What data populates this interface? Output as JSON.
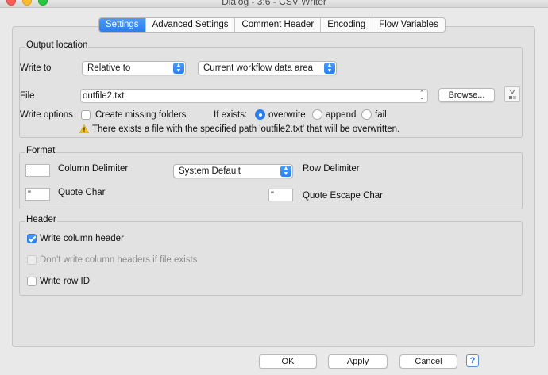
{
  "window": {
    "title": "Dialog - 3:6 - CSV Writer"
  },
  "tabs": [
    {
      "label": "Settings"
    },
    {
      "label": "Advanced Settings"
    },
    {
      "label": "Comment Header"
    },
    {
      "label": "Encoding"
    },
    {
      "label": "Flow Variables"
    }
  ],
  "output_location": {
    "title": "Output location",
    "write_to_label": "Write to",
    "write_to_value": "Relative to",
    "area_value": "Current workflow data area",
    "file_label": "File",
    "file_value": "outfile2.txt",
    "browse_label": "Browse...",
    "write_options_label": "Write options",
    "create_missing_folders": "Create missing folders",
    "if_exists_label": "If exists:",
    "overwrite_label": "overwrite",
    "append_label": "append",
    "fail_label": "fail",
    "warning": "There exists a file with the specified path 'outfile2.txt' that will be overwritten."
  },
  "format": {
    "title": "Format",
    "column_delimiter_label": "Column Delimiter",
    "column_delimiter_value": "",
    "row_delimiter_label": "Row Delimiter",
    "row_delimiter_value": "System Default",
    "quote_char_label": "Quote Char",
    "quote_char_value": "\"",
    "quote_escape_label": "Quote Escape Char",
    "quote_escape_value": "\""
  },
  "header": {
    "title": "Header",
    "write_column_header": "Write column header",
    "dont_write_if_exists": "Don't write column headers if file exists",
    "write_row_id": "Write row ID"
  },
  "buttons": {
    "ok": "OK",
    "apply": "Apply",
    "cancel": "Cancel",
    "help": "?"
  },
  "colors": {
    "accent": "#2a7ef0",
    "warning": "#f5c518"
  }
}
